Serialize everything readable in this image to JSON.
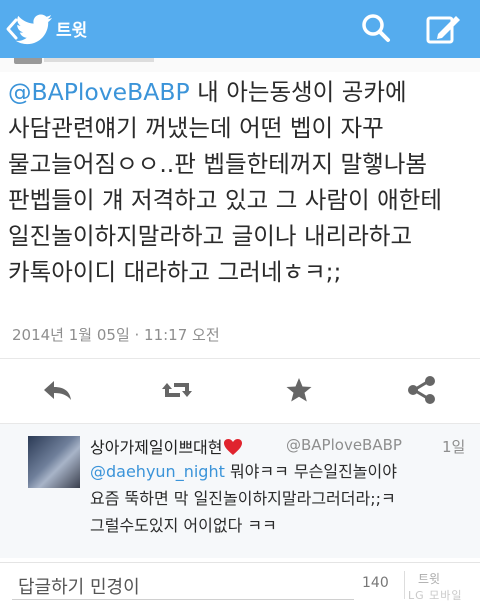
{
  "header": {
    "title": "트윗",
    "back_icon": "chevron-left-icon",
    "logo_icon": "twitter-bird-icon",
    "search_icon": "search-icon",
    "compose_icon": "compose-icon",
    "bar_color": "#55acee"
  },
  "tweet": {
    "mention": "@BAPloveBABP",
    "text": " 내 아는동생이 공카에\n사담관련얘기 꺼냈는데 어떤 벱이 자꾸\n물고늘어짐ㅇㅇ..판 벱들한테꺼지 말햏나봄\n판벱들이 걔 저격하고 있고 그 사람이 애한테\n일진놀이하지말라하고 글이나 내리라하고\n카톡아이디 대라하고 그러네ㅎㅋ;;",
    "timestamp": "2014년 1월 05일 · 11:17 오전",
    "mention_color": "#3b94d9"
  },
  "actions": {
    "reply_icon": "reply-icon",
    "retweet_icon": "retweet-icon",
    "favorite_icon": "star-icon",
    "share_icon": "share-icon"
  },
  "reply": {
    "name": "상아가제일이쁘대현",
    "name_icon": "heart-icon",
    "handle": "@BAPloveBABP",
    "age": "1일",
    "mention": "@daehyun_night",
    "text": " 뭐야ㅋㅋ 무슨일진놀이야\n요즘 뚝하면 막 일진놀이하지말라그러더라;;ㅋ\n그럴수도있지 어이없다 ㅋㅋ"
  },
  "composer": {
    "placeholder": "답글하기 민경이",
    "char_count": "140",
    "send_label": "트윗",
    "watermark": "LG 모바일"
  }
}
